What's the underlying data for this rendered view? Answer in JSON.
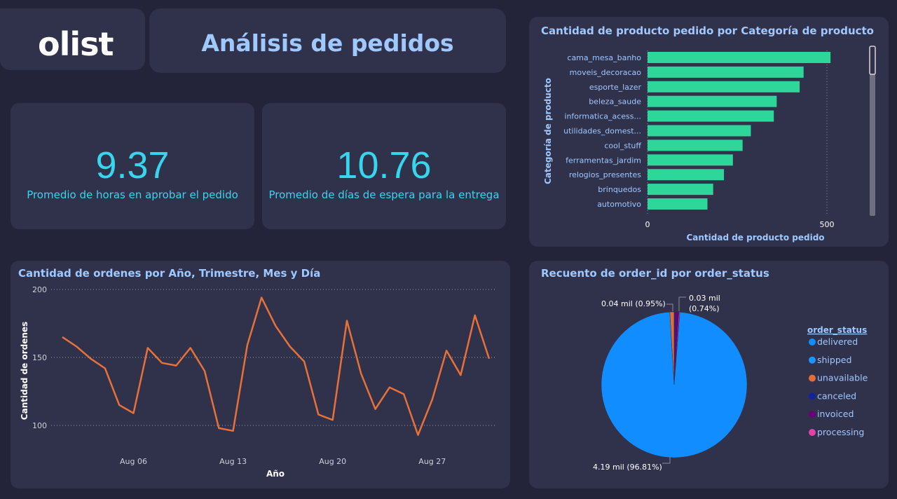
{
  "header": {
    "logo": "olist",
    "title": "Análisis de pedidos"
  },
  "kpis": [
    {
      "value": "9.37",
      "label": "Promedio de horas en aprobar el pedido"
    },
    {
      "value": "10.76",
      "label": "Promedio de días de espera para la entrega"
    }
  ],
  "colors": {
    "bar": "#2fd69a",
    "line": "#e8713a",
    "kpi": "#38d6ee",
    "title": "#9fc8ff"
  },
  "bar_chart": {
    "title": "Cantidad de producto pedido por Categoría de producto",
    "xlabel": "Cantidad de producto pedido",
    "ylabel": "Categoría de producto"
  },
  "line_chart": {
    "title": "Cantidad de ordenes por Año, Trimestre, Mes y Día",
    "xlabel": "Año",
    "ylabel": "Cantidad de ordenes"
  },
  "pie_chart": {
    "title": "Recuento de order_id por order_status",
    "legend_title": "order_status"
  },
  "chart_data": [
    {
      "type": "bar",
      "orientation": "horizontal",
      "title": "Cantidad de producto pedido por Categoría de producto",
      "xlabel": "Cantidad de producto pedido",
      "ylabel": "Categoría de producto",
      "categories": [
        "cama_mesa_banho",
        "moveis_decoracao",
        "esporte_lazer",
        "beleza_saude",
        "informatica_acess...",
        "utilidades_domest...",
        "cool_stuff",
        "ferramentas_jardim",
        "relogios_presentes",
        "brinquedos",
        "automotivo"
      ],
      "values": [
        510,
        435,
        424,
        360,
        352,
        288,
        265,
        238,
        213,
        183,
        167
      ],
      "xticks": [
        "0",
        "500"
      ],
      "xlim": [
        0,
        560
      ],
      "grid": "dotted vertical"
    },
    {
      "type": "line",
      "title": "Cantidad de ordenes por Año, Trimestre, Mes y Día",
      "xlabel": "Año",
      "ylabel": "Cantidad de ordenes",
      "x": [
        "2018-08-01",
        "2018-08-02",
        "2018-08-03",
        "2018-08-04",
        "2018-08-05",
        "2018-08-06",
        "2018-08-07",
        "2018-08-08",
        "2018-08-09",
        "2018-08-10",
        "2018-08-11",
        "2018-08-12",
        "2018-08-13",
        "2018-08-14",
        "2018-08-15",
        "2018-08-16",
        "2018-08-17",
        "2018-08-18",
        "2018-08-19",
        "2018-08-20",
        "2018-08-21",
        "2018-08-22",
        "2018-08-23",
        "2018-08-24",
        "2018-08-25",
        "2018-08-26",
        "2018-08-27",
        "2018-08-28",
        "2018-08-29",
        "2018-08-30",
        "2018-08-31"
      ],
      "y": [
        165,
        158,
        149,
        142,
        115,
        109,
        157,
        146,
        144,
        157,
        140,
        98,
        96,
        159,
        194,
        173,
        158,
        147,
        108,
        104,
        177,
        138,
        112,
        128,
        123,
        93,
        119,
        155,
        137,
        181,
        149
      ],
      "xticks": [
        "Aug 06",
        "Aug 13",
        "Aug 20",
        "Aug 27"
      ],
      "yticks": [
        100,
        150,
        200
      ],
      "ylim": [
        80,
        205
      ],
      "grid": "dotted horizontal"
    },
    {
      "type": "pie",
      "title": "Recuento de order_id por order_status",
      "legend_title": "order_status",
      "legend_position": "right",
      "slices": [
        {
          "name": "delivered",
          "value": 96.81,
          "color": "#118dff"
        },
        {
          "name": "shipped",
          "value": 0.0,
          "color": "#1a95ff"
        },
        {
          "name": "unavailable",
          "value": 0.95,
          "color": "#e66c37"
        },
        {
          "name": "canceled",
          "value": 0.3,
          "color": "#12239e"
        },
        {
          "name": "invoiced",
          "value": 0.74,
          "color": "#6b007b"
        },
        {
          "name": "processing",
          "value": 0.2,
          "color": "#e044a7"
        }
      ],
      "data_labels": [
        "4.19 mil (96.81%)",
        "0.04 mil (0.95%)",
        "0.03 mil",
        "(0.74%)"
      ]
    }
  ]
}
